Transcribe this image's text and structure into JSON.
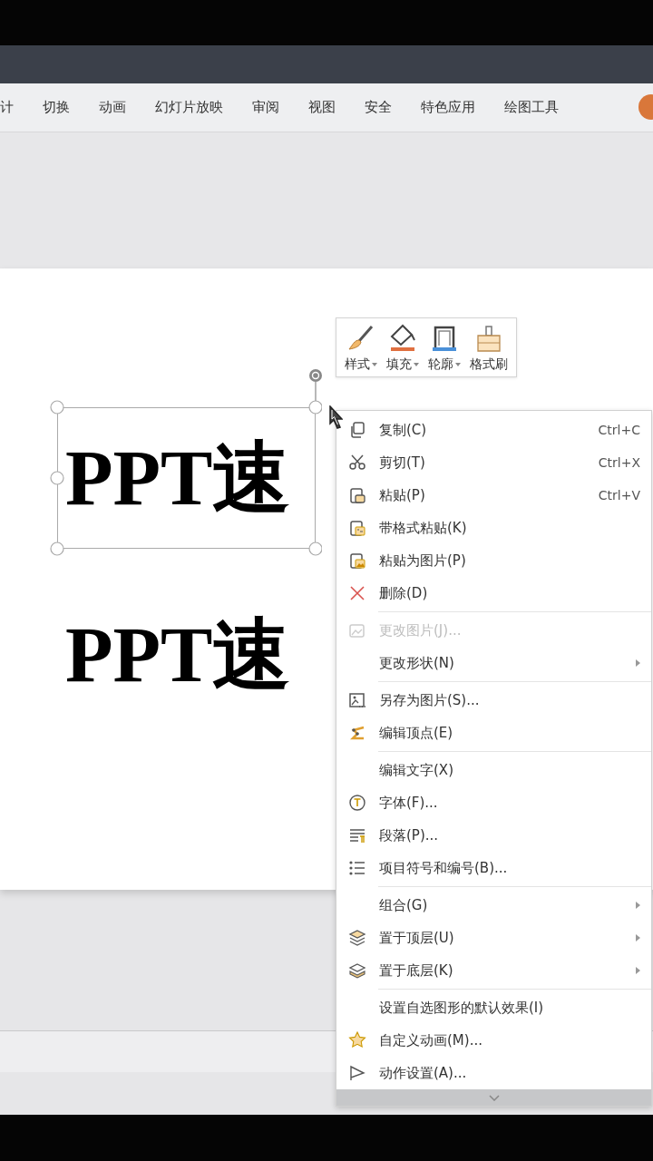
{
  "ribbon_tabs": [
    {
      "label": "计"
    },
    {
      "label": "切换"
    },
    {
      "label": "动画"
    },
    {
      "label": "幻灯片放映"
    },
    {
      "label": "审阅"
    },
    {
      "label": "视图"
    },
    {
      "label": "安全"
    },
    {
      "label": "特色应用"
    },
    {
      "label": "绘图工具"
    }
  ],
  "slide": {
    "text_boxes": [
      {
        "text": "PPT速",
        "selected": true
      },
      {
        "text": "PPT速",
        "selected": false
      }
    ]
  },
  "mini_toolbar": {
    "buttons": [
      {
        "kind": "style",
        "label": "样式",
        "dropdown": true
      },
      {
        "kind": "fill",
        "label": "填充",
        "dropdown": true
      },
      {
        "kind": "outline",
        "label": "轮廓",
        "dropdown": true
      },
      {
        "kind": "painter",
        "label": "格式刷",
        "dropdown": false
      }
    ]
  },
  "context_menu": {
    "groups": [
      [
        {
          "kind": "copy",
          "label": "复制(C)",
          "shortcut": "Ctrl+C",
          "disabled": false,
          "submenu": false
        },
        {
          "kind": "cut",
          "label": "剪切(T)",
          "shortcut": "Ctrl+X",
          "disabled": false,
          "submenu": false
        },
        {
          "kind": "paste",
          "label": "粘贴(P)",
          "shortcut": "Ctrl+V",
          "disabled": false,
          "submenu": false
        },
        {
          "kind": "paste-format",
          "label": "带格式粘贴(K)",
          "disabled": false,
          "submenu": false
        },
        {
          "kind": "paste-picture",
          "label": "粘贴为图片(P)",
          "disabled": false,
          "submenu": false
        },
        {
          "kind": "delete",
          "label": "删除(D)",
          "disabled": false,
          "submenu": false
        }
      ],
      [
        {
          "kind": "change-picture",
          "label": "更改图片(J)...",
          "disabled": true,
          "submenu": false
        },
        {
          "kind": "plain",
          "label": "更改形状(N)",
          "disabled": false,
          "submenu": true
        }
      ],
      [
        {
          "kind": "save-picture",
          "label": "另存为图片(S)...",
          "disabled": false,
          "submenu": false
        },
        {
          "kind": "edit-points",
          "label": "编辑顶点(E)",
          "disabled": false,
          "submenu": false
        }
      ],
      [
        {
          "kind": "plain",
          "label": "编辑文字(X)",
          "disabled": false,
          "submenu": false
        },
        {
          "kind": "font",
          "label": "字体(F)...",
          "disabled": false,
          "submenu": false
        },
        {
          "kind": "paragraph",
          "label": "段落(P)...",
          "disabled": false,
          "submenu": false
        },
        {
          "kind": "bullets",
          "label": "项目符号和编号(B)...",
          "disabled": false,
          "submenu": false
        }
      ],
      [
        {
          "kind": "plain",
          "label": "组合(G)",
          "disabled": false,
          "submenu": true
        },
        {
          "kind": "layer-top",
          "label": "置于顶层(U)",
          "disabled": false,
          "submenu": true
        },
        {
          "kind": "layer-bottom",
          "label": "置于底层(K)",
          "disabled": false,
          "submenu": true
        }
      ],
      [
        {
          "kind": "plain",
          "label": "设置自选图形的默认效果(I)",
          "disabled": false,
          "submenu": false
        },
        {
          "kind": "animation",
          "label": "自定义动画(M)...",
          "disabled": false,
          "submenu": false
        },
        {
          "kind": "action",
          "label": "动作设置(A)...",
          "disabled": false,
          "submenu": false
        }
      ]
    ]
  }
}
